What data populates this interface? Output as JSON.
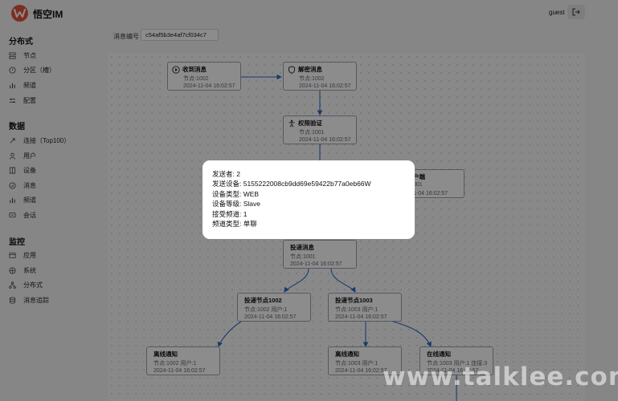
{
  "app": {
    "brand": "悟空IM",
    "user": "guest"
  },
  "sidebar": {
    "sections": [
      {
        "title": "分布式",
        "items": [
          {
            "label": "节点",
            "icon": "server-icon"
          },
          {
            "label": "分区（槽）",
            "icon": "slot-icon"
          },
          {
            "label": "频道",
            "icon": "bar-chart-icon"
          },
          {
            "label": "配置",
            "icon": "sliders-icon"
          }
        ]
      },
      {
        "title": "数据",
        "items": [
          {
            "label": "连接（Top100）",
            "icon": "link-icon"
          },
          {
            "label": "用户",
            "icon": "user-icon"
          },
          {
            "label": "设备",
            "icon": "device-icon"
          },
          {
            "label": "消息",
            "icon": "message-check-icon"
          },
          {
            "label": "频道",
            "icon": "bar-chart-icon"
          },
          {
            "label": "会话",
            "icon": "chat-icon"
          }
        ]
      },
      {
        "title": "监控",
        "items": [
          {
            "label": "应用",
            "icon": "app-icon"
          },
          {
            "label": "系统",
            "icon": "system-icon"
          },
          {
            "label": "分布式",
            "icon": "network-icon"
          },
          {
            "label": "消息追踪",
            "icon": "database-icon"
          }
        ]
      }
    ]
  },
  "search": {
    "label": "消息编号",
    "value": "c54af5b3e4af7cf034c7"
  },
  "flow": {
    "nodes": [
      {
        "title": "收到消息",
        "sub": "节点:1002",
        "time": "2024-11-04 16:02:57",
        "icon": "play-circle-icon"
      },
      {
        "title": "解密消息",
        "sub": "节点:1002",
        "time": "2024-11-04 16:02:57",
        "icon": "shield-icon"
      },
      {
        "title": "权限验证",
        "sub": "节点:1001",
        "time": "2024-11-04 16:02:57",
        "icon": "person-icon"
      },
      {
        "title": "户端",
        "sub": "001",
        "time": "1-04 16:02:57",
        "icon": ""
      },
      {
        "title": "投递消息",
        "sub": "节点:1001",
        "time": "2024-11-04 16:02:57",
        "icon": ""
      },
      {
        "title": "投递节点1002",
        "sub": "节点:1002 用户:1",
        "time": "2024-11-04 16:02:57",
        "icon": ""
      },
      {
        "title": "投递节点1003",
        "sub": "节点:1003 用户:1",
        "time": "2024-11-04 16:02:57",
        "icon": ""
      },
      {
        "title": "离线通知",
        "sub": "节点:1002 用户:1",
        "time": "2024-11-04 16:02:57",
        "icon": ""
      },
      {
        "title": "离线通知",
        "sub": "节点:1003 用户:1",
        "time": "2024-11-04 16:02:57",
        "icon": ""
      },
      {
        "title": "在线通知",
        "sub": "节点:1003 用户:1 连接:3",
        "time": "2024-11-04 16:02:57",
        "icon": ""
      }
    ]
  },
  "dialog": {
    "lines": [
      "发送者: 2",
      "发送设备: 5155222008cb9dd69e59422b77a0eb66W",
      "设备类型: WEB",
      "设备等级: Slave",
      "接受频道: 1",
      "频道类型: 单聊"
    ]
  },
  "watermark": "www.talklee.com",
  "colors": {
    "brand": "#e5533d",
    "edge": "#2f6bc4"
  }
}
